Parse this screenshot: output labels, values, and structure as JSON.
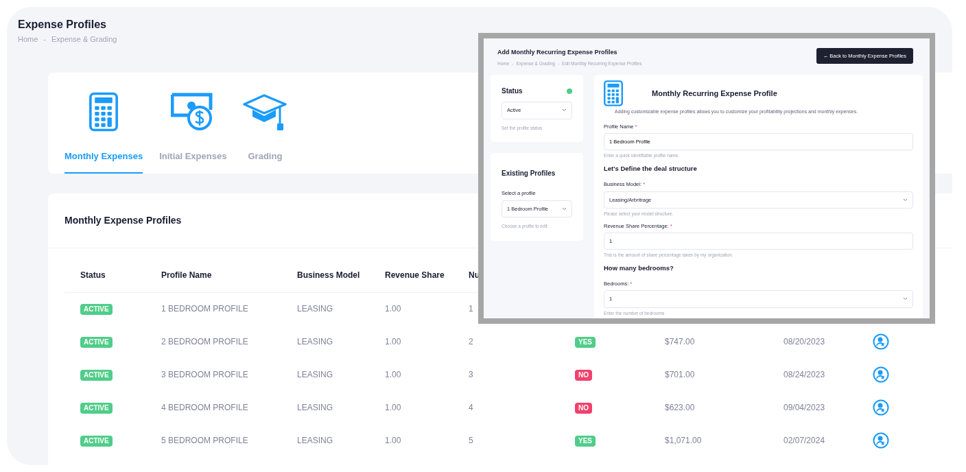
{
  "page": {
    "title": "Expense Profiles",
    "breadcrumb": [
      "Home",
      "Expense & Grading"
    ],
    "separator": "-"
  },
  "tabs": [
    {
      "label": "Monthly Expenses",
      "selected": true
    },
    {
      "label": "Initial Expenses",
      "selected": false
    },
    {
      "label": "Grading",
      "selected": false
    }
  ],
  "profiles_card": {
    "title": "Monthly Expense Profiles"
  },
  "table": {
    "columns": [
      "Status",
      "Profile Name",
      "Business Model",
      "Revenue Share",
      "Nu"
    ],
    "rows": [
      {
        "status": "ACTIVE",
        "name": "1 BEDROOM PROFILE",
        "model": "LEASING",
        "share": "1.00",
        "bedrooms": "1"
      },
      {
        "status": "ACTIVE",
        "name": "2 BEDROOM PROFILE",
        "model": "LEASING",
        "share": "1.00",
        "bedrooms": "2",
        "va": {
          "label": "YES",
          "on": true
        },
        "total": "$747.00",
        "date": "08/20/2023",
        "manage": true
      },
      {
        "status": "ACTIVE",
        "name": "3 BEDROOM PROFILE",
        "model": "LEASING",
        "share": "1.00",
        "bedrooms": "3",
        "va": {
          "label": "NO",
          "on": false
        },
        "total": "$701.00",
        "date": "08/24/2023",
        "manage": true
      },
      {
        "status": "ACTIVE",
        "name": "4 BEDROOM PROFILE",
        "model": "LEASING",
        "share": "1.00",
        "bedrooms": "4",
        "va": {
          "label": "NO",
          "on": false
        },
        "total": "$623.00",
        "date": "09/04/2023",
        "manage": true
      },
      {
        "status": "ACTIVE",
        "name": "5 BEDROOM PROFILE",
        "model": "LEASING",
        "share": "1.00",
        "bedrooms": "5",
        "va": {
          "label": "YES",
          "on": true
        },
        "total": "$1,071.00",
        "date": "02/07/2024",
        "manage": true
      }
    ]
  },
  "overlay": {
    "title": "Add Monthly Recurring Expense Profiles",
    "breadcrumb": [
      "Home",
      "Expense & Grading",
      "Edit Monthly Recurring Expense Profiles"
    ],
    "separator": "-",
    "back_button": "← Back to Monthly Expense Profiles",
    "status_card": {
      "title": "Status",
      "active": true,
      "select": "Active",
      "help": "Set the profile status"
    },
    "existing_card": {
      "title": "Existing Profiles",
      "label": "Select a profile",
      "select": "1 Bedroom Profile",
      "help": "Choose a profile to edit"
    },
    "form": {
      "title": "Monthly Recurring Expense Profile",
      "description": "Adding customizable expense profiles allows you to customize your profitability projections and monthly expenses.",
      "items": [
        {
          "kind": "field",
          "label": "Profile Name",
          "required": "*",
          "value": "1 Bedroom Profile",
          "help": "Enter a quick identifiable profile name."
        },
        {
          "kind": "heading",
          "label": "Let's Define the deal structure"
        },
        {
          "kind": "select",
          "label": "Business Model:",
          "required": "*",
          "value": "Leasing/Arbritrage",
          "help": "Please select your model structure."
        },
        {
          "kind": "field",
          "label": "Revenue Share Percentage:",
          "required": "*",
          "value": "1",
          "help": "This is the amount of share percentage taken by my organization."
        },
        {
          "kind": "heading",
          "label": "How many bedrooms?"
        },
        {
          "kind": "select",
          "label": "Bedrooms:",
          "required": "*",
          "value": "1",
          "help": "Enter the number of bedrooms"
        }
      ]
    }
  }
}
